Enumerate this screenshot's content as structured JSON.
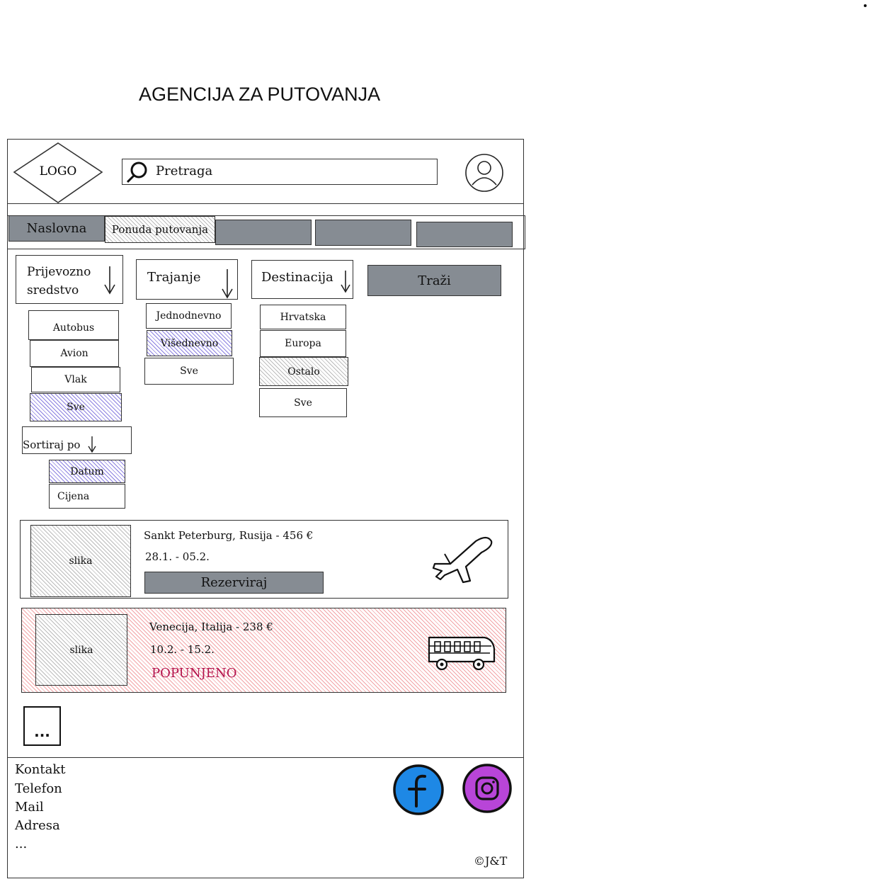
{
  "page_title": "AGENCIJA ZA PUTOVANJA",
  "header": {
    "logo": "LOGO",
    "search_placeholder": "Pretraga"
  },
  "nav": {
    "tabs": [
      {
        "label": "Naslovna"
      },
      {
        "label": "Ponuda putovanja"
      },
      {
        "label": ""
      },
      {
        "label": ""
      },
      {
        "label": ""
      }
    ]
  },
  "filters": {
    "transport": {
      "label": "Prijevozno sredstvo",
      "options": [
        "Autobus",
        "Avion",
        "Vlak",
        "Sve"
      ],
      "selected": "Sve"
    },
    "duration": {
      "label": "Trajanje",
      "options": [
        "Jednodnevno",
        "Višednevno",
        "Sve"
      ],
      "selected": "Višednevno"
    },
    "destination": {
      "label": "Destinacija",
      "options": [
        "Hrvatska",
        "Europa",
        "Ostalo",
        "Sve"
      ],
      "selected": "Ostalo"
    },
    "search_button": "Traži",
    "sort": {
      "label": "Sortiraj po",
      "options": [
        "Datum",
        "Cijena"
      ],
      "selected": "Datum"
    }
  },
  "trips": [
    {
      "image_label": "slika",
      "title": "Sankt Peterburg, Rusija - 456 €",
      "dates": "28.1. - 05.2.",
      "action": "Rezerviraj",
      "transport_icon": "airplane-icon",
      "status": "available"
    },
    {
      "image_label": "slika",
      "title": "Venecija, Italija - 238 €",
      "dates": "10.2. - 15.2.",
      "status_label": "POPUNJENO",
      "transport_icon": "bus-icon",
      "status": "full"
    }
  ],
  "more_button": "...",
  "footer": {
    "links": [
      "Kontakt",
      "Telefon",
      "Mail",
      "Adresa",
      "..."
    ],
    "copyright": "©J&T",
    "social": [
      "facebook-icon",
      "instagram-icon"
    ]
  },
  "colors": {
    "grey_fill": "#868c93",
    "selected_hatch": "#8a7ee0",
    "full_hatch": "#f2a3a6",
    "full_text": "#b3134d",
    "facebook": "#1e88e5",
    "instagram": "#b845d8"
  }
}
